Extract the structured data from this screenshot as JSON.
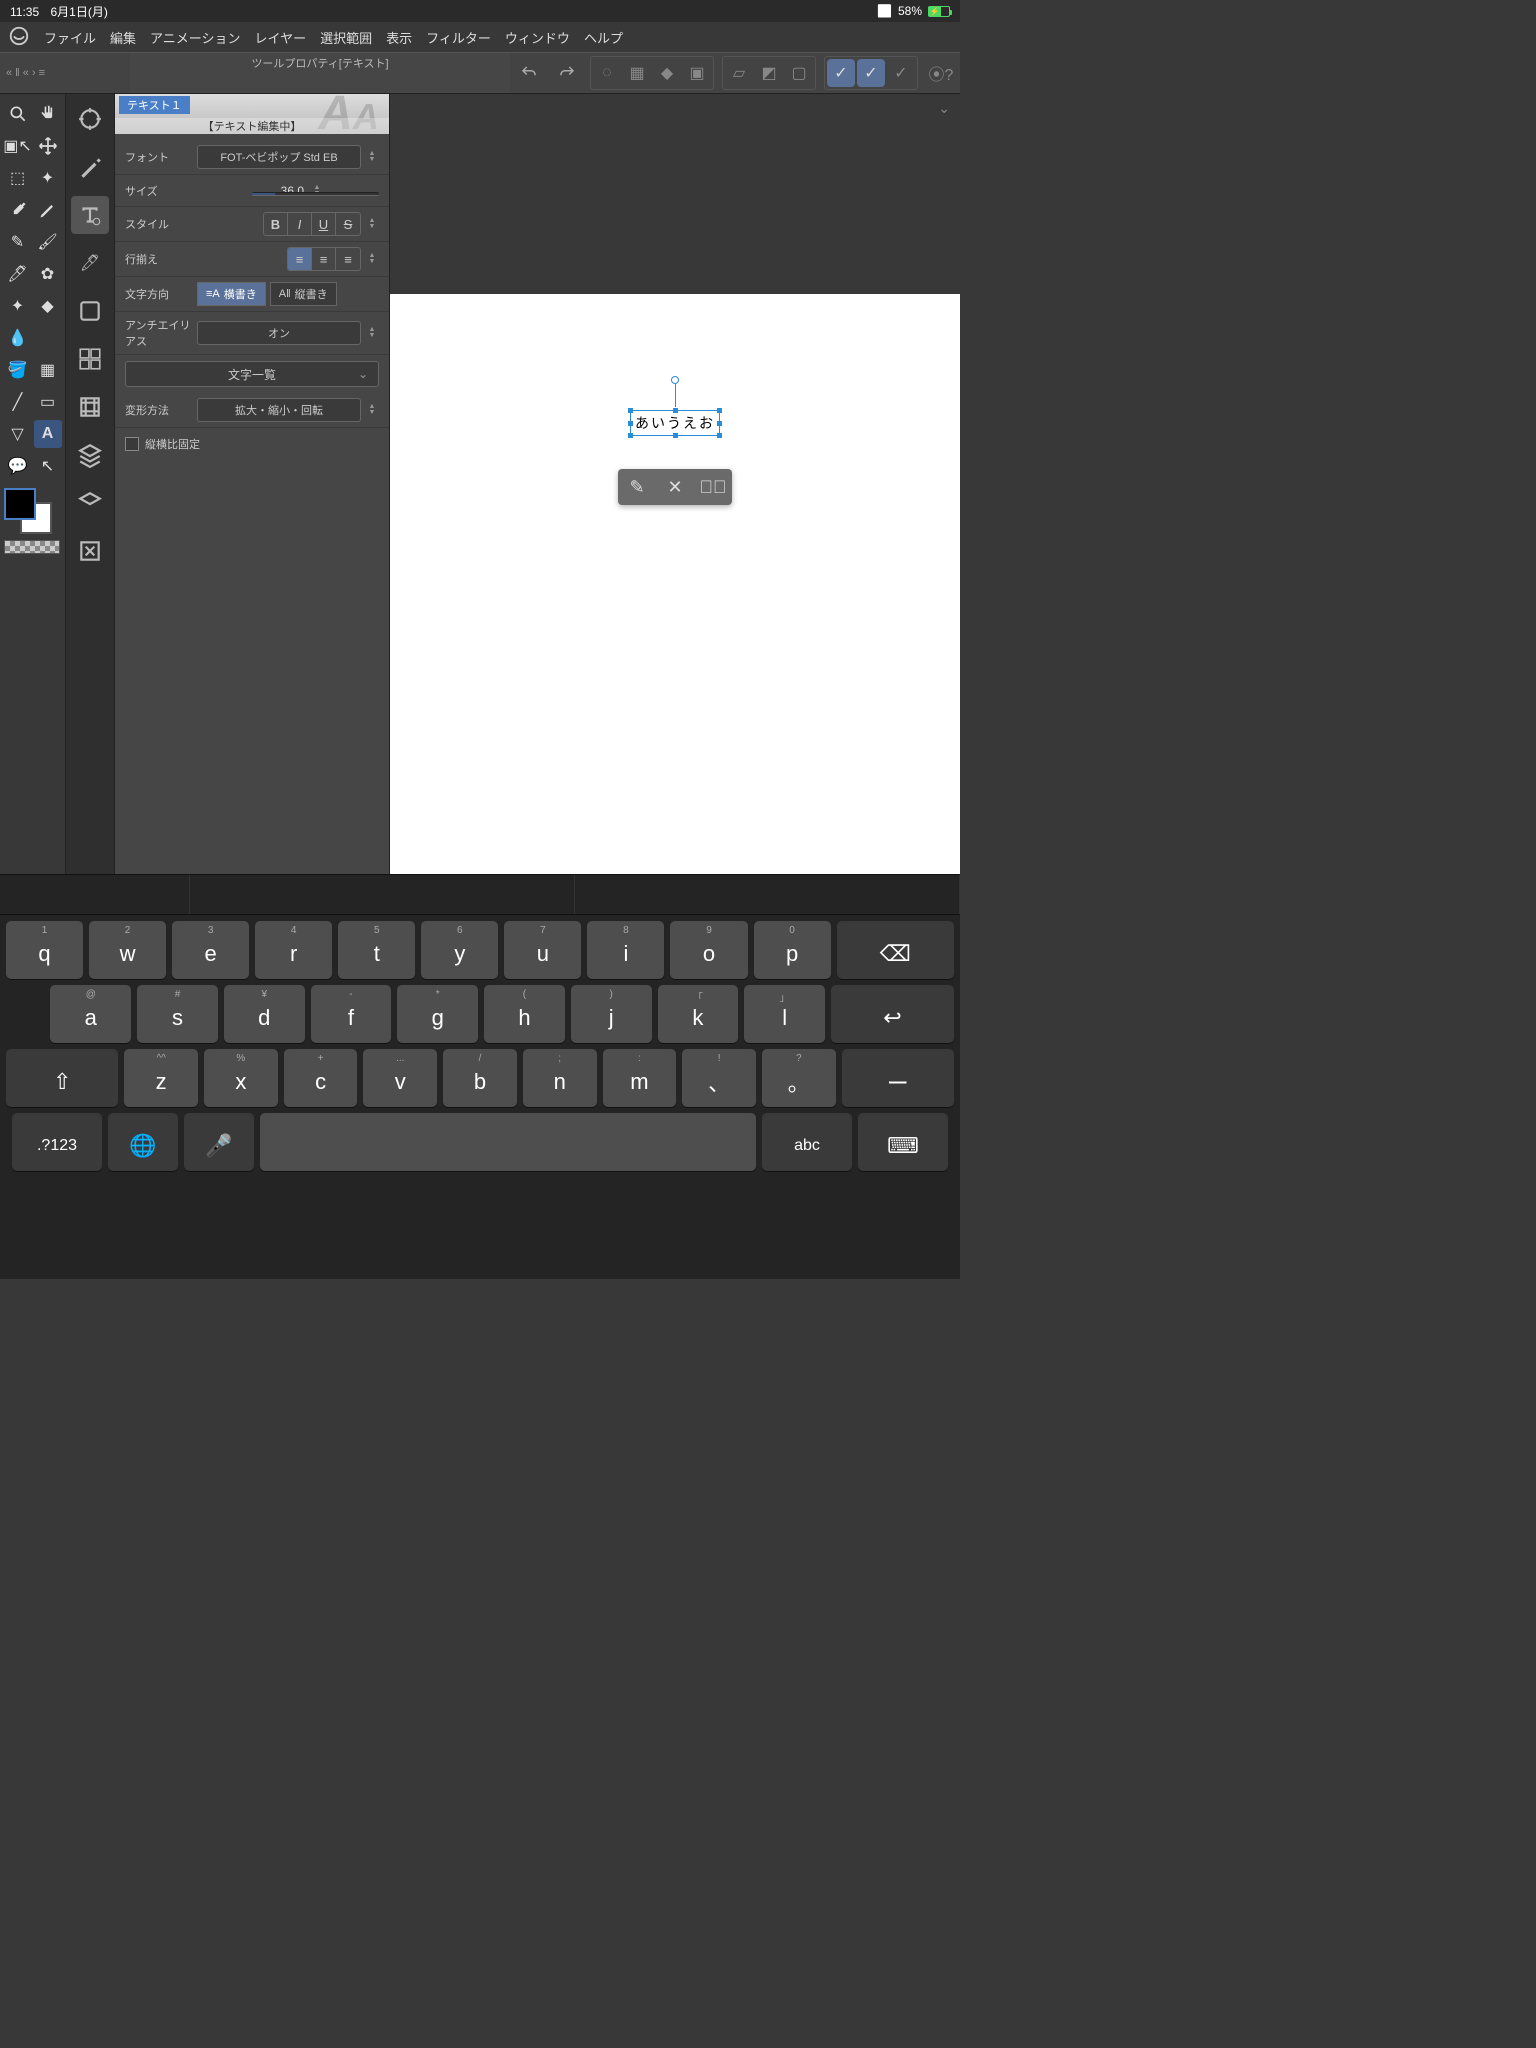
{
  "status": {
    "time": "11:35",
    "date": "6月1日(月)",
    "battery_pct": "58%"
  },
  "menu": {
    "file": "ファイル",
    "edit": "編集",
    "anim": "アニメーション",
    "layer": "レイヤー",
    "select": "選択範囲",
    "view": "表示",
    "filter": "フィルター",
    "window": "ウィンドウ",
    "help": "ヘルプ"
  },
  "panel": {
    "title": "ツールプロパティ[テキスト]",
    "preset": "テキスト１",
    "editing": "【テキスト編集中】",
    "font_label": "フォント",
    "font_value": "FOT-ベビポップ Std EB",
    "size_label": "サイズ",
    "size_value": "36.0",
    "style_label": "スタイル",
    "align_label": "行揃え",
    "dir_label": "文字方向",
    "dir_h": "横書き",
    "dir_v": "縦書き",
    "aa_label": "アンチエイリアス",
    "aa_value": "オン",
    "charlist": "文字一覧",
    "transform_label": "変形方法",
    "transform_value": "拡大・縮小・回転",
    "aspect": "縦横比固定"
  },
  "canvas": {
    "text": "あいうえお"
  },
  "keyboard": {
    "row1": [
      {
        "a": "1",
        "m": "q"
      },
      {
        "a": "2",
        "m": "w"
      },
      {
        "a": "3",
        "m": "e"
      },
      {
        "a": "4",
        "m": "r"
      },
      {
        "a": "5",
        "m": "t"
      },
      {
        "a": "6",
        "m": "y"
      },
      {
        "a": "7",
        "m": "u"
      },
      {
        "a": "8",
        "m": "i"
      },
      {
        "a": "9",
        "m": "o"
      },
      {
        "a": "0",
        "m": "p"
      }
    ],
    "row2": [
      {
        "a": "@",
        "m": "a"
      },
      {
        "a": "#",
        "m": "s"
      },
      {
        "a": "¥",
        "m": "d"
      },
      {
        "a": "-",
        "m": "f"
      },
      {
        "a": "*",
        "m": "g"
      },
      {
        "a": "(",
        "m": "h"
      },
      {
        "a": ")",
        "m": "j"
      },
      {
        "a": "「",
        "m": "k"
      },
      {
        "a": "」",
        "m": "l"
      }
    ],
    "row3": [
      {
        "a": "^^",
        "m": "z"
      },
      {
        "a": "%",
        "m": "x"
      },
      {
        "a": "+",
        "m": "c"
      },
      {
        "a": "...",
        "m": "v"
      },
      {
        "a": "/",
        "m": "b"
      },
      {
        "a": ";",
        "m": "n"
      },
      {
        "a": ":",
        "m": "m"
      },
      {
        "a": "!",
        "m": "、"
      },
      {
        "a": "?",
        "m": "。"
      }
    ],
    "mode": ".?123",
    "abc": "abc",
    "dash": "ー"
  }
}
